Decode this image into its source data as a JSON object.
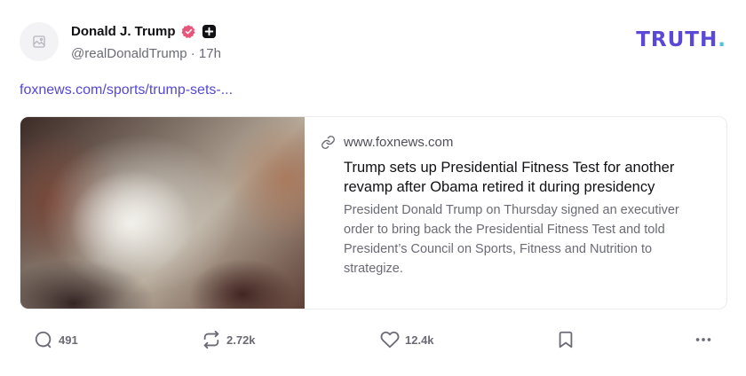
{
  "post": {
    "author": {
      "display_name": "Donald J. Trump",
      "handle": "@realDonaldTrump",
      "separator": "·",
      "time": "17h",
      "avatar_icon": "image-placeholder-icon",
      "verified_icon": "verified-badge-icon",
      "plus_icon": "plus-badge-icon"
    },
    "link_text": "foxnews.com/sports/trump-sets-...",
    "card": {
      "domain": "www.foxnews.com",
      "title": "Trump sets up Presidential Fitness Test for another revamp after Obama retired it during presidency",
      "description": "President Donald Trump on Thursday signed an executiver order to bring back the Presidential Fitness Test and told President’s Council on Sports, Fitness and Nutrition to strategize."
    },
    "actions": {
      "replies": "491",
      "retruths": "2.72k",
      "likes": "12.4k"
    }
  },
  "brand": {
    "logo_text": "TRUTH",
    "logo_dot": ".",
    "primary_color": "#5a48d6",
    "accent_color": "#4cc4e0",
    "verified_color": "#e8557a"
  }
}
